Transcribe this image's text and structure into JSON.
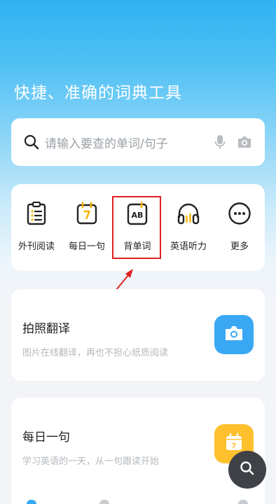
{
  "headline": "快捷、准确的词典工具",
  "search": {
    "placeholder": "请输入要查的单词/句子"
  },
  "quick_tools": [
    {
      "label": "外刊阅读",
      "icon": "clipboard-icon"
    },
    {
      "label": "每日一句",
      "icon": "calendar-icon"
    },
    {
      "label": "背单词",
      "icon": "ab-card-icon"
    },
    {
      "label": "英语听力",
      "icon": "headphones-icon"
    },
    {
      "label": "更多",
      "icon": "more-dots-icon"
    }
  ],
  "cards": [
    {
      "title": "拍照翻译",
      "subtitle": "图片在线翻译，再也不担心纸质阅读",
      "icon": "camera-icon",
      "color": "#3aa7f5"
    },
    {
      "title": "每日一句",
      "subtitle": "学习英语的一天，从一句跟读开始",
      "icon": "calendar-icon",
      "color": "#ffc02e"
    }
  ],
  "calendar_digit": "7",
  "ab_text": "AB",
  "colors": {
    "accent": "#3aa7f5",
    "highlight": "#e02020",
    "yellow": "#f5b300"
  }
}
